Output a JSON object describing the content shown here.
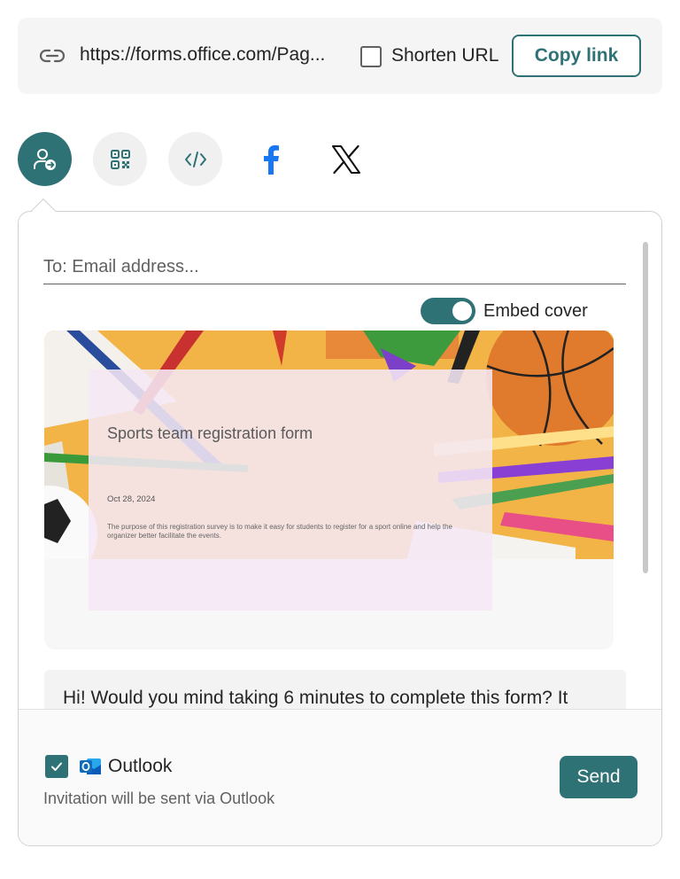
{
  "link_bar": {
    "url": "https://forms.office.com/Pag...",
    "shorten_label": "Shorten URL",
    "shorten_checked": false,
    "copy_label": "Copy link"
  },
  "share_options": [
    {
      "icon": "email-invite-icon",
      "active": true
    },
    {
      "icon": "qr-code-icon",
      "active": false
    },
    {
      "icon": "embed-code-icon",
      "active": false
    },
    {
      "icon": "facebook-icon",
      "active": false
    },
    {
      "icon": "x-twitter-icon",
      "active": false
    }
  ],
  "email": {
    "placeholder": "To: Email address...",
    "value": ""
  },
  "embed_cover": {
    "label": "Embed cover",
    "enabled": true
  },
  "preview": {
    "title": "Sports team registration form",
    "date": "Oct 28, 2024",
    "description": "The purpose of this registration survey is to make it easy for students to register for a sport online and help the organizer better facilitate the events."
  },
  "message": {
    "text": "Hi! Would you mind taking 6 minutes to complete this form? It"
  },
  "footer": {
    "outlook_checked": true,
    "outlook_label": "Outlook",
    "note": "Invitation will be sent via Outlook",
    "send_label": "Send"
  },
  "colors": {
    "accent": "#2f7275",
    "facebook": "#1877f2",
    "outlook": "#0f6cbd"
  }
}
